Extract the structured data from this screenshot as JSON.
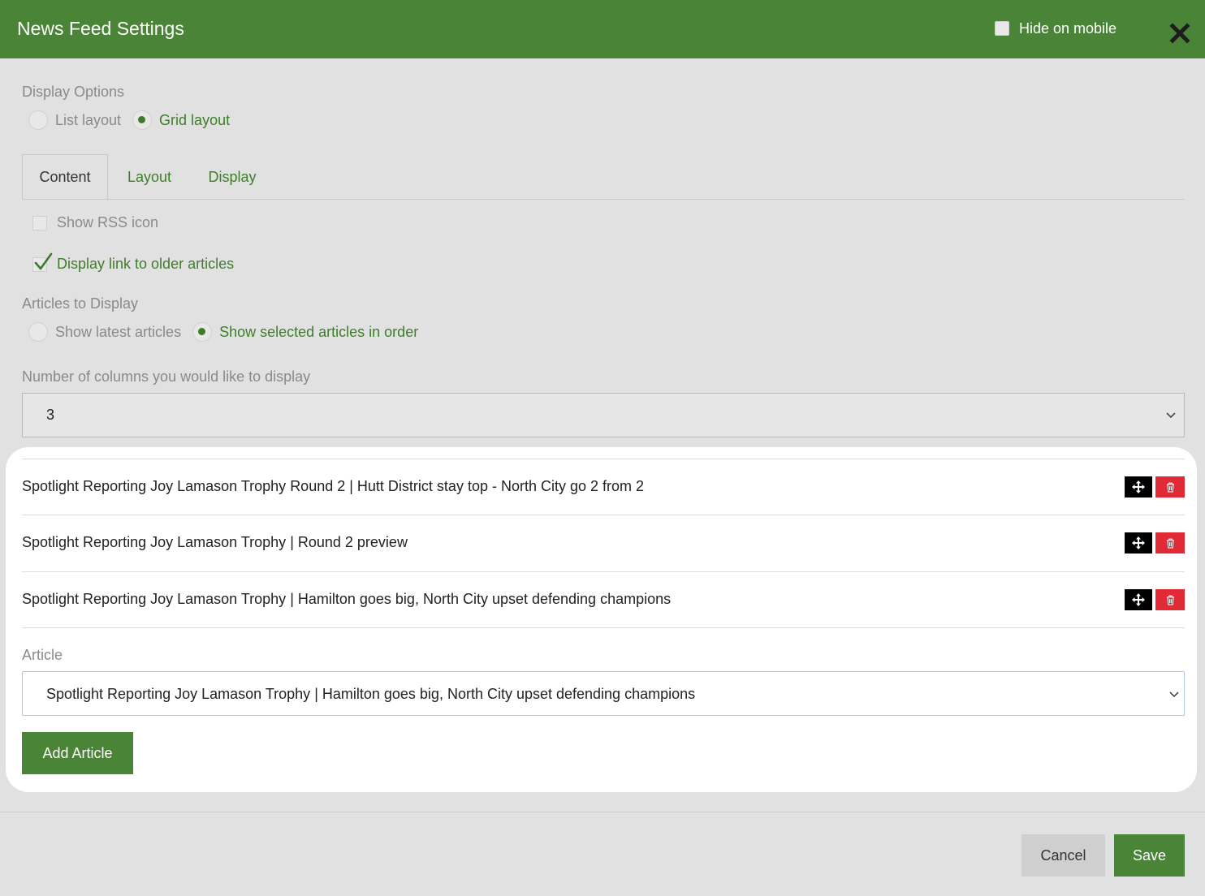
{
  "header": {
    "title": "News Feed Settings",
    "hide_on_mobile_label": "Hide on mobile",
    "hide_on_mobile_checked": false
  },
  "display_options": {
    "label": "Display Options",
    "options": [
      {
        "label": "List layout",
        "selected": false
      },
      {
        "label": "Grid layout",
        "selected": true
      }
    ]
  },
  "tabs": [
    {
      "label": "Content",
      "active": true
    },
    {
      "label": "Layout",
      "active": false
    },
    {
      "label": "Display",
      "active": false
    }
  ],
  "content": {
    "show_rss_icon": {
      "label": "Show RSS icon",
      "checked": false
    },
    "display_link_older": {
      "label": "Display link to older articles",
      "checked": true
    }
  },
  "articles_to_display": {
    "label": "Articles to Display",
    "options": [
      {
        "label": "Show latest articles",
        "selected": false
      },
      {
        "label": "Show selected articles in order",
        "selected": true
      }
    ]
  },
  "columns": {
    "label": "Number of columns you would like to display",
    "value": "3"
  },
  "selected_articles": [
    {
      "title": "Spotlight Reporting Joy Lamason Trophy Round 2 | Hutt District stay top - North City go 2 from 2"
    },
    {
      "title": "Spotlight Reporting Joy Lamason Trophy | Round 2 preview"
    },
    {
      "title": "Spotlight Reporting Joy Lamason Trophy | Hamilton goes big, North City upset defending champions"
    }
  ],
  "article_picker": {
    "label": "Article",
    "value": "Spotlight Reporting Joy Lamason Trophy | Hamilton goes big, North City upset defending champions",
    "add_button_label": "Add Article"
  },
  "footer": {
    "cancel_label": "Cancel",
    "save_label": "Save"
  },
  "colors": {
    "brand_green": "#4a8437",
    "delete_red": "#e02a36",
    "selected_text_green": "#3f7d2c"
  }
}
